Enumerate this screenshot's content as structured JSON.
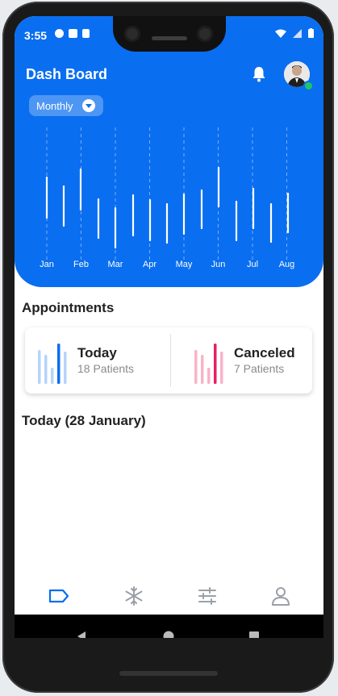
{
  "status_bar": {
    "time": "3:55"
  },
  "header": {
    "title": "Dash Board",
    "filter": {
      "selected": "Monthly"
    }
  },
  "chart_data": {
    "type": "bar",
    "categories": [
      "Jan",
      "Feb",
      "Mar",
      "Apr",
      "May",
      "Jun",
      "Jul",
      "Aug"
    ],
    "grid": true,
    "legend": "none"
  },
  "appointments": {
    "title": "Appointments",
    "today": {
      "label": "Today",
      "count": "18 Patients"
    },
    "canceled": {
      "label": "Canceled",
      "count": "7 Patients"
    }
  },
  "today_section": {
    "title": "Today (28 January)"
  },
  "bottom_nav": {
    "items": [
      {
        "icon": "tag-icon",
        "active": true
      },
      {
        "icon": "snowflake-icon",
        "active": false
      },
      {
        "icon": "sliders-icon",
        "active": false
      },
      {
        "icon": "person-icon",
        "active": false
      }
    ]
  },
  "colors": {
    "primary": "#0a6ef0",
    "accent_pink": "#e91e63",
    "online": "#22c55e"
  }
}
